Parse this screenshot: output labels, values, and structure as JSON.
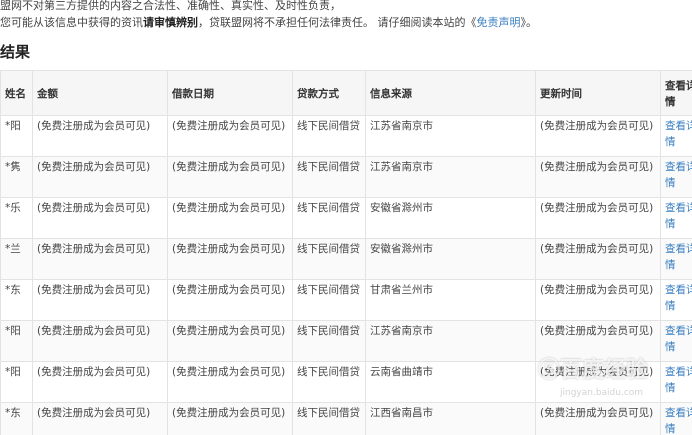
{
  "notice": {
    "line1": "盟网不对第三方提供的内容之合法性、准确性、真实性、及时性负责，",
    "line2_prefix": "您可能从该信息中获得的资讯",
    "line2_bold": "请审慎辨别",
    "line2_middle": "，贷联盟网将不承担任何法律责任。 请仔细阅读本站的《",
    "line2_link": "免责声明",
    "line2_suffix": "》。"
  },
  "section_title": "结果",
  "table": {
    "headers": {
      "name": "姓名",
      "amount": "金额",
      "date": "借款日期",
      "method": "贷款方式",
      "source": "信息来源",
      "updated": "更新时间",
      "detail": "查看详情"
    },
    "rows": [
      {
        "name": "*阳",
        "amount": "(免费注册成为会员可见)",
        "date": "(免费注册成为会员可见)",
        "method": "线下民间借贷",
        "source": "江苏省南京市",
        "updated": "(免费注册成为会员可见)",
        "detail": "查看详情"
      },
      {
        "name": "*隽",
        "amount": "(免费注册成为会员可见)",
        "date": "(免费注册成为会员可见)",
        "method": "线下民间借贷",
        "source": "江苏省南京市",
        "updated": "(免费注册成为会员可见)",
        "detail": "查看详情"
      },
      {
        "name": "*乐",
        "amount": "(免费注册成为会员可见)",
        "date": "(免费注册成为会员可见)",
        "method": "线下民间借贷",
        "source": "安徽省滁州市",
        "updated": "(免费注册成为会员可见)",
        "detail": "查看详情"
      },
      {
        "name": "*兰",
        "amount": "(免费注册成为会员可见)",
        "date": "(免费注册成为会员可见)",
        "method": "线下民间借贷",
        "source": "安徽省滁州市",
        "updated": "(免费注册成为会员可见)",
        "detail": "查看详情"
      },
      {
        "name": "*东",
        "amount": "(免费注册成为会员可见)",
        "date": "(免费注册成为会员可见)",
        "method": "线下民间借贷",
        "source": "甘肃省兰州市",
        "updated": "(免费注册成为会员可见)",
        "detail": "查看详情"
      },
      {
        "name": "*阳",
        "amount": "(免费注册成为会员可见)",
        "date": "(免费注册成为会员可见)",
        "method": "线下民间借贷",
        "source": "江苏省南京市",
        "updated": "(免费注册成为会员可见)",
        "detail": "查看详情"
      },
      {
        "name": "*阳",
        "amount": "(免费注册成为会员可见)",
        "date": "(免费注册成为会员可见)",
        "method": "线下民间借贷",
        "source": "云南省曲靖市",
        "updated": "(免费注册成为会员可见)",
        "detail": "查看详情"
      },
      {
        "name": "*东",
        "amount": "(免费注册成为会员可见)",
        "date": "(免费注册成为会员可见)",
        "method": "线下民间借贷",
        "source": "江西省南昌市",
        "updated": "(免费注册成为会员可见)",
        "detail": "查看详情"
      }
    ]
  },
  "watermark": {
    "main": "Ⓢ百度经验",
    "sub": "jingyan.baidu.com"
  },
  "colors": {
    "link": "#3a7ec0",
    "border": "#e3e3e3",
    "header_bg": "#f6f6f6"
  }
}
